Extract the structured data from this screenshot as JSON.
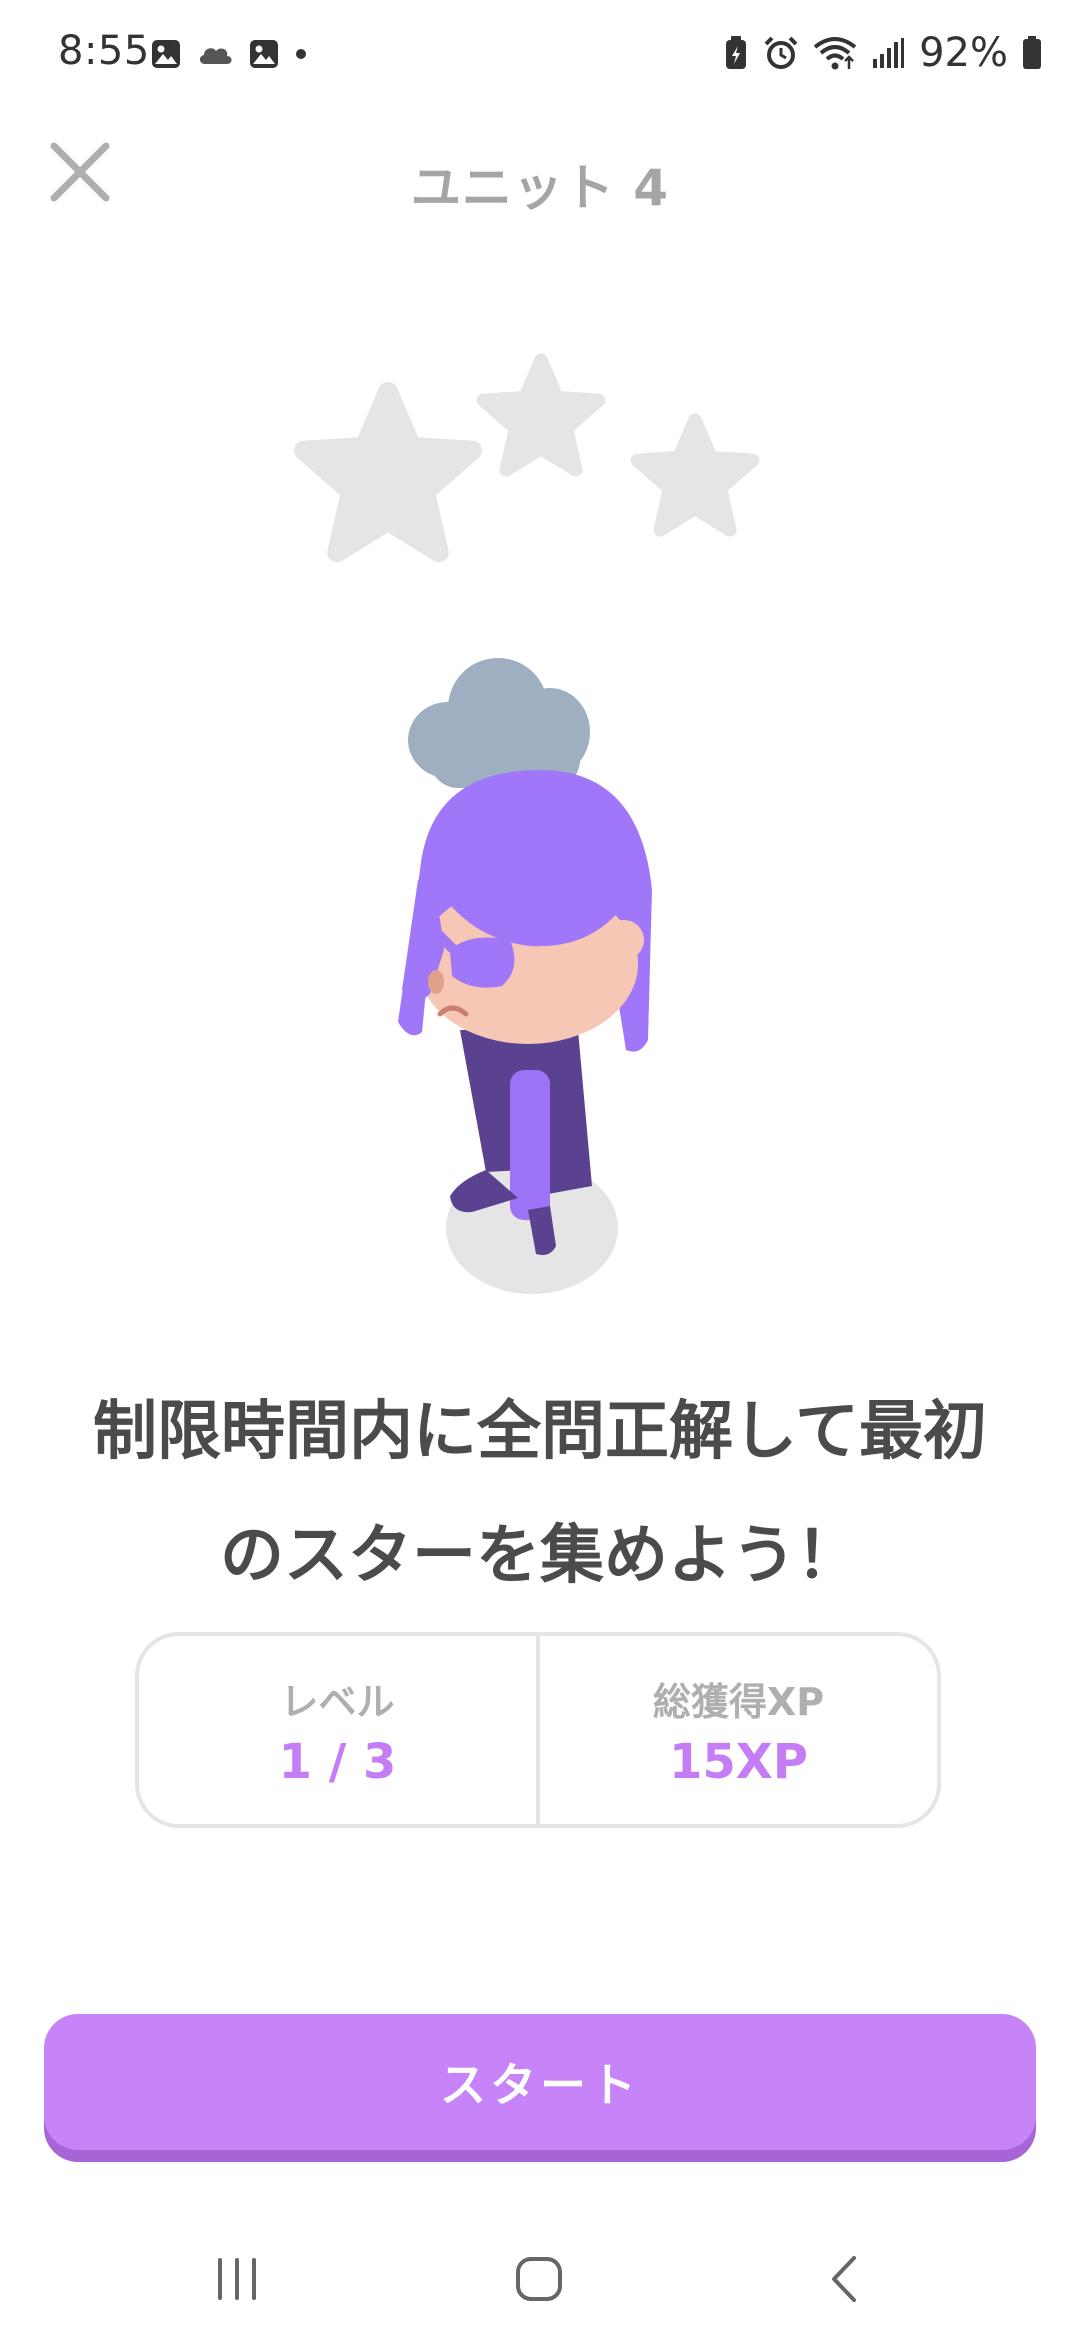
{
  "status_bar": {
    "time": "8:55",
    "battery": "92%",
    "left_icons": [
      "image-icon",
      "cloud-icon",
      "image-icon",
      "dot-icon"
    ],
    "right_icons": [
      "battery-saver-icon",
      "alarm-icon",
      "wifi-icon",
      "signal-icon",
      "battery-icon"
    ]
  },
  "header": {
    "title": "ユニット 4",
    "close_icon": "close-icon"
  },
  "stars": {
    "earned": 0,
    "total": 3,
    "empty_color": "#e5e5e5"
  },
  "message": {
    "line1": "制限時間内に全問正解して最初",
    "line2": "のスターを集めよう！"
  },
  "stats": {
    "level_label": "レベル",
    "level_value": "1 / 3",
    "xp_label": "総獲得XP",
    "xp_value": "15XP"
  },
  "start_button": {
    "label": "スタート"
  },
  "nav_bar": {
    "recent_icon": "recent-apps-icon",
    "home_icon": "home-icon",
    "back_icon": "back-icon"
  },
  "colors": {
    "accent": "#c784f8",
    "accent_shadow": "#a664d6",
    "stat_value": "#c47df5",
    "muted_text": "#afafaf",
    "border": "#e5e5e5",
    "character_hair": "#a077f8",
    "character_body": "#5b4291",
    "cloud": "#9dafc0"
  }
}
